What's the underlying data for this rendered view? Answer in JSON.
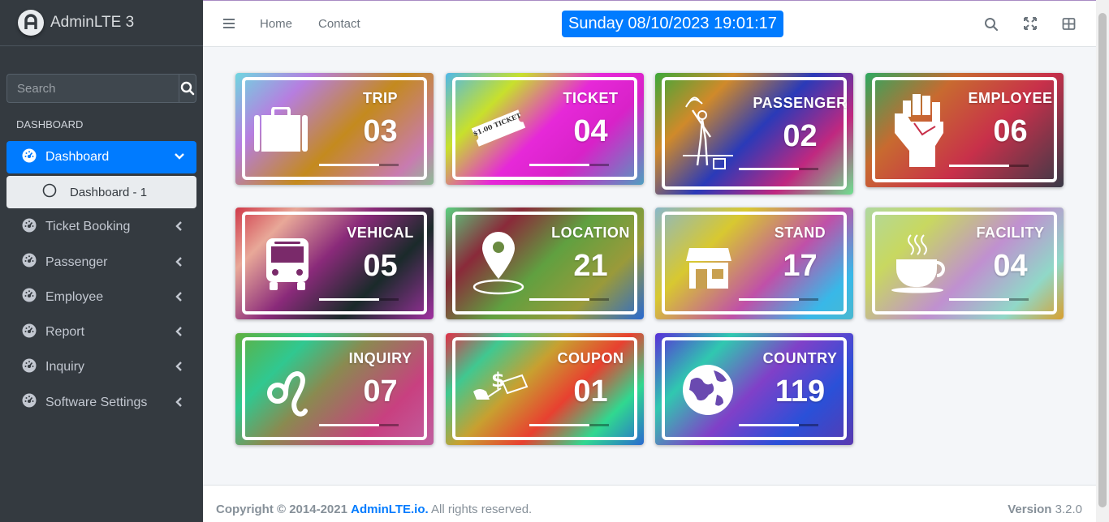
{
  "brand": {
    "name": "AdminLTE 3"
  },
  "sidebar": {
    "search_placeholder": "Search",
    "header": "DASHBOARD",
    "items": [
      {
        "label": "Dashboard",
        "icon": "tachometer-icon",
        "active": true,
        "expanded": true
      },
      {
        "label": "Ticket Booking",
        "icon": "tachometer-icon"
      },
      {
        "label": "Passenger",
        "icon": "tachometer-icon"
      },
      {
        "label": "Employee",
        "icon": "tachometer-icon"
      },
      {
        "label": "Report",
        "icon": "tachometer-icon"
      },
      {
        "label": "Inquiry",
        "icon": "tachometer-icon"
      },
      {
        "label": "Software Settings",
        "icon": "tachometer-icon"
      }
    ],
    "sub_items": [
      {
        "label": "Dashboard - 1",
        "icon": "circle-icon"
      }
    ]
  },
  "header": {
    "links": [
      "Home",
      "Contact"
    ],
    "datetime": "Sunday 08/10/2023 19:01:17",
    "icons": [
      "menu-icon",
      "search-icon",
      "fullscreen-icon",
      "grid-icon"
    ]
  },
  "cards": [
    {
      "title": "TRIP",
      "count": "03",
      "icon": "suitcase-icon",
      "bar_fill": 0.75
    },
    {
      "title": "TICKET",
      "count": "04",
      "icon": "ticket-icon",
      "ticket_text": "$1.00 TICKET",
      "bar_fill": 0.75
    },
    {
      "title": "PASSENGER",
      "count": "02",
      "icon": "passenger-icon",
      "bar_fill": 0.75
    },
    {
      "title": "EMPLOYEE",
      "count": "06",
      "icon": "fist-icon",
      "bar_fill": 0.75
    },
    {
      "title": "VEHICAL",
      "count": "05",
      "icon": "bus-icon",
      "bar_fill": 0.75
    },
    {
      "title": "LOCATION",
      "count": "21",
      "icon": "map-pin-icon",
      "bar_fill": 0.75
    },
    {
      "title": "STAND",
      "count": "17",
      "icon": "store-icon",
      "bar_fill": 0.75
    },
    {
      "title": "FACILITY",
      "count": "04",
      "icon": "coffee-cup-icon",
      "bar_fill": 0.75
    },
    {
      "title": "INQUIRY",
      "count": "07",
      "icon": "leo-icon",
      "bar_fill": 0.75
    },
    {
      "title": "COUPON",
      "count": "01",
      "icon": "coupon-icon",
      "bar_fill": 0.75
    },
    {
      "title": "COUNTRY",
      "count": "119",
      "icon": "globe-icon",
      "bar_fill": 0.75
    }
  ],
  "footer": {
    "copyright": "Copyright © 2014-2021",
    "link": "AdminLTE.io.",
    "rights": "All rights reserved.",
    "version_label": "Version",
    "version": "3.2.0"
  },
  "colors": {
    "sidebar": "#343a40",
    "accent": "#007bff",
    "background": "#f4f6f9"
  }
}
